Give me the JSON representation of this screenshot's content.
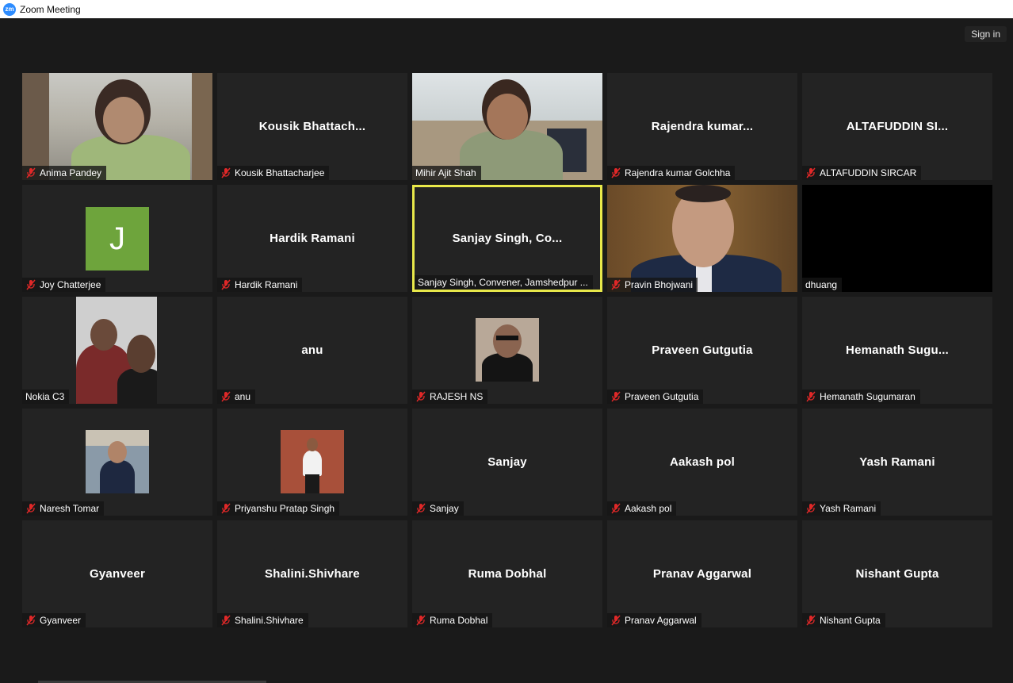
{
  "window": {
    "title": "Zoom Meeting",
    "logo_text": "zm"
  },
  "header": {
    "sign_in_label": "Sign in"
  },
  "participants": [
    {
      "display_name": "",
      "label": "Anima Pandey",
      "muted": true,
      "kind": "video"
    },
    {
      "display_name": "Kousik  Bhattach...",
      "label": "Kousik Bhattacharjee",
      "muted": true,
      "kind": "name"
    },
    {
      "display_name": "",
      "label": "Mihir Ajit Shah",
      "muted": false,
      "kind": "video"
    },
    {
      "display_name": "Rajendra  kumar...",
      "label": "Rajendra kumar Golchha",
      "muted": true,
      "kind": "name"
    },
    {
      "display_name": "ALTAFUDDIN  SI...",
      "label": "ALTAFUDDIN SIRCAR",
      "muted": true,
      "kind": "name"
    },
    {
      "display_name": "J",
      "label": "Joy Chatterjee",
      "muted": true,
      "kind": "avatar"
    },
    {
      "display_name": "Hardik Ramani",
      "label": "Hardik Ramani",
      "muted": true,
      "kind": "name"
    },
    {
      "display_name": "Sanjay  Singh,  Co...",
      "label": "Sanjay Singh, Convener, Jamshedpur ...",
      "muted": false,
      "kind": "name",
      "speaking": true
    },
    {
      "display_name": "",
      "label": "Pravin Bhojwani",
      "muted": true,
      "kind": "video"
    },
    {
      "display_name": "",
      "label": "dhuang",
      "muted": false,
      "kind": "black"
    },
    {
      "display_name": "",
      "label": "Nokia C3",
      "muted": false,
      "kind": "photo"
    },
    {
      "display_name": "anu",
      "label": "anu",
      "muted": true,
      "kind": "name"
    },
    {
      "display_name": "",
      "label": "RAJESH NS",
      "muted": true,
      "kind": "photo"
    },
    {
      "display_name": "Praveen Gutgutia",
      "label": "Praveen Gutgutia",
      "muted": true,
      "kind": "name"
    },
    {
      "display_name": "Hemanath  Sugu...",
      "label": "Hemanath Sugumaran",
      "muted": true,
      "kind": "name"
    },
    {
      "display_name": "",
      "label": "Naresh Tomar",
      "muted": true,
      "kind": "photo"
    },
    {
      "display_name": "",
      "label": "Priyanshu Pratap Singh",
      "muted": true,
      "kind": "photo"
    },
    {
      "display_name": "Sanjay",
      "label": "Sanjay",
      "muted": true,
      "kind": "name"
    },
    {
      "display_name": "Aakash pol",
      "label": "Aakash pol",
      "muted": true,
      "kind": "name"
    },
    {
      "display_name": "Yash Ramani",
      "label": "Yash Ramani",
      "muted": true,
      "kind": "name"
    },
    {
      "display_name": "Gyanveer",
      "label": "Gyanveer",
      "muted": true,
      "kind": "name"
    },
    {
      "display_name": "Shalini.Shivhare",
      "label": "Shalini.Shivhare",
      "muted": true,
      "kind": "name"
    },
    {
      "display_name": "Ruma Dobhal",
      "label": "Ruma Dobhal",
      "muted": true,
      "kind": "name"
    },
    {
      "display_name": "Pranav Aggarwal",
      "label": "Pranav Aggarwal",
      "muted": true,
      "kind": "name"
    },
    {
      "display_name": "Nishant Gupta",
      "label": "Nishant Gupta",
      "muted": true,
      "kind": "name"
    }
  ],
  "colors": {
    "background": "#1a1a1a",
    "tile": "#232323",
    "speaking_border": "#e8e84a",
    "mute_icon": "#e02828",
    "avatar": "#6ea43c"
  }
}
